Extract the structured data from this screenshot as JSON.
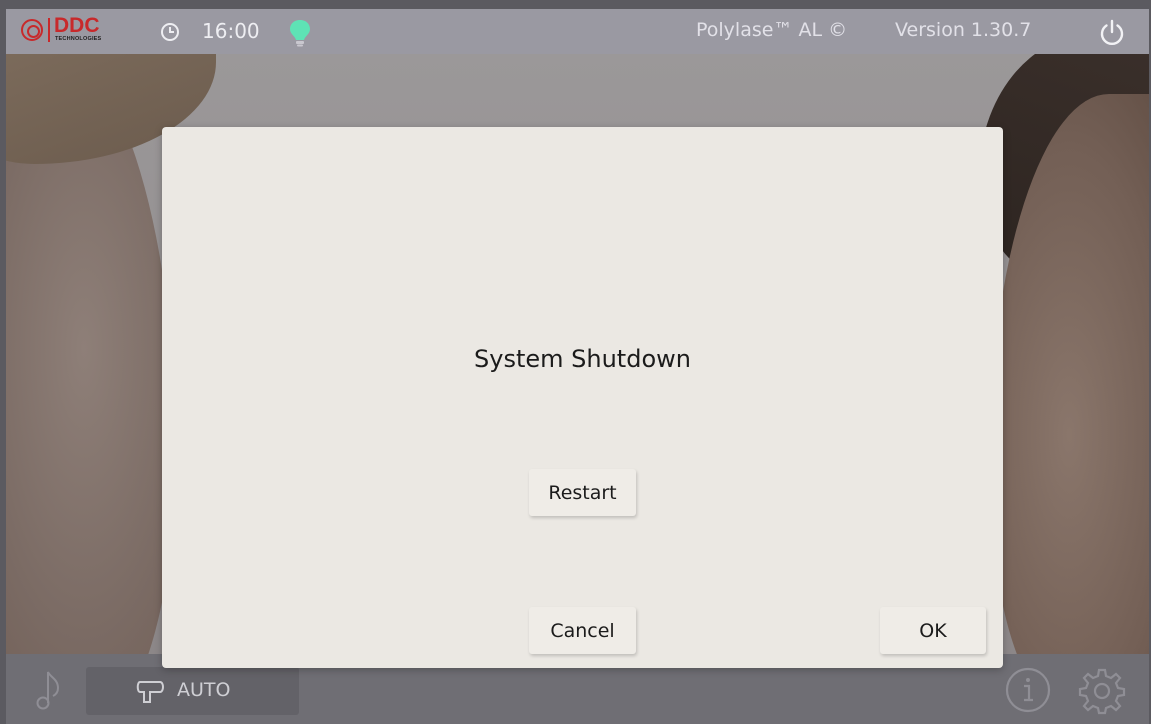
{
  "header": {
    "logo_text": "DDC",
    "logo_subtext": "TECHNOLOGIES",
    "time": "16:00",
    "product": "Polylase™ AL ©",
    "version": "Version 1.30.7"
  },
  "dialog": {
    "title": "System Shutdown",
    "restart_label": "Restart",
    "cancel_label": "Cancel",
    "ok_label": "OK"
  },
  "footer": {
    "mode_label": "AUTO"
  },
  "icons": {
    "logo": "ddc-logo",
    "clock": "clock-icon",
    "status": "lightbulb-icon",
    "power": "power-icon",
    "music": "music-note-icon",
    "applicator": "applicator-icon",
    "info": "info-icon",
    "settings": "gear-icon"
  },
  "colors": {
    "brand_red": "#c8292b",
    "status_green": "#5ee3b5",
    "dialog_bg": "#ebe8e3"
  }
}
